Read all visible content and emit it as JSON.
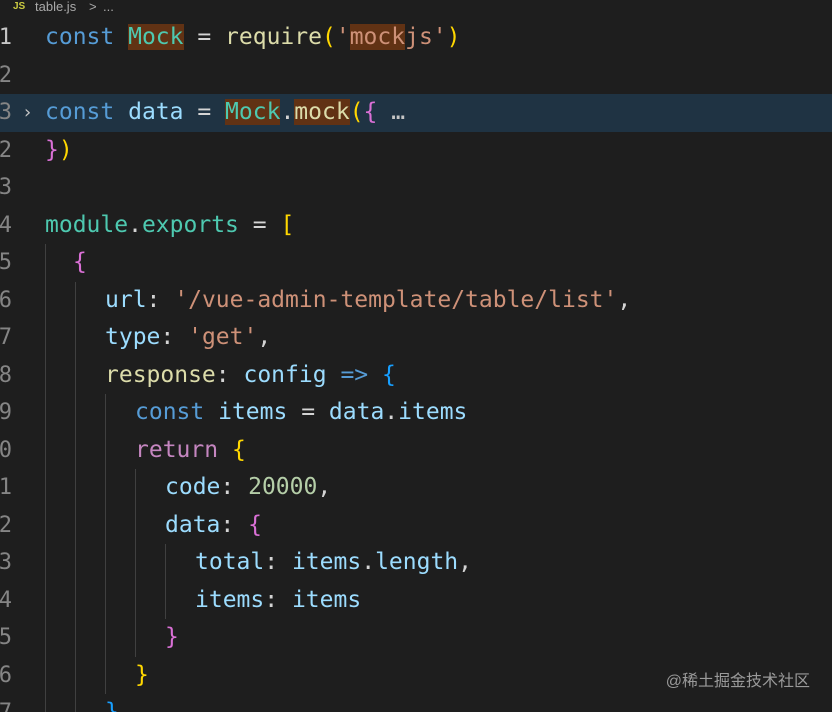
{
  "breadcrumb": {
    "icon": "JS",
    "file": "table.js",
    "sep": ">",
    "more": "..."
  },
  "lines": {
    "l1": {
      "num": "1",
      "t1": "const",
      "t2": " ",
      "t3": "Mock",
      "t4": " = ",
      "t5": "require",
      "t6": "(",
      "t7": "'",
      "t8": "mock",
      "t9": "js'",
      "t10": ")"
    },
    "l2": {
      "num": "2"
    },
    "l3": {
      "num": "3",
      "fold": "›",
      "t1": "const",
      "t2": " ",
      "t3": "data",
      "t4": " = ",
      "t5": "Mock",
      "t6": ".",
      "t7": "mock",
      "t8": "(",
      "t9": "{",
      "t10": " …"
    },
    "l4": {
      "num": "2",
      "t1": "}",
      "t2": ")"
    },
    "l5": {
      "num": "3"
    },
    "l6": {
      "num": "4",
      "t1": "module",
      "t2": ".",
      "t3": "exports",
      "t4": " = ",
      "t5": "["
    },
    "l7": {
      "num": "5",
      "t1": "{"
    },
    "l8": {
      "num": "6",
      "t1": "url",
      "t2": ": ",
      "t3": "'/vue-admin-template/table/list'",
      "t4": ","
    },
    "l9": {
      "num": "7",
      "t1": "type",
      "t2": ": ",
      "t3": "'get'",
      "t4": ","
    },
    "l10": {
      "num": "8",
      "t1": "response",
      "t2": ": ",
      "t3": "config",
      "t4": " ",
      "t5": "=>",
      "t6": " ",
      "t7": "{"
    },
    "l11": {
      "num": "9",
      "t1": "const",
      "t2": " ",
      "t3": "items",
      "t4": " = ",
      "t5": "data",
      "t6": ".",
      "t7": "items"
    },
    "l12": {
      "num": "0",
      "t1": "return",
      "t2": " ",
      "t3": "{"
    },
    "l13": {
      "num": "1",
      "t1": "code",
      "t2": ": ",
      "t3": "20000",
      "t4": ","
    },
    "l14": {
      "num": "2",
      "t1": "data",
      "t2": ": ",
      "t3": "{"
    },
    "l15": {
      "num": "3",
      "t1": "total",
      "t2": ": ",
      "t3": "items",
      "t4": ".",
      "t5": "length",
      "t6": ","
    },
    "l16": {
      "num": "4",
      "t1": "items",
      "t2": ": ",
      "t3": "items"
    },
    "l17": {
      "num": "5",
      "t1": "}"
    },
    "l18": {
      "num": "6",
      "t1": "}"
    },
    "l19": {
      "num": "7",
      "t1": "}"
    }
  },
  "watermark": "@稀土掘金技术社区",
  "colors": {
    "background": "#1e1e1e",
    "keyword": "#569cd6",
    "control": "#c586c0",
    "variable": "#9cdcfe",
    "class": "#4ec9b0",
    "function": "#dcdcaa",
    "string": "#ce9178",
    "number": "#b5cea8",
    "highlight": "#1f3343",
    "match": "#613214"
  }
}
